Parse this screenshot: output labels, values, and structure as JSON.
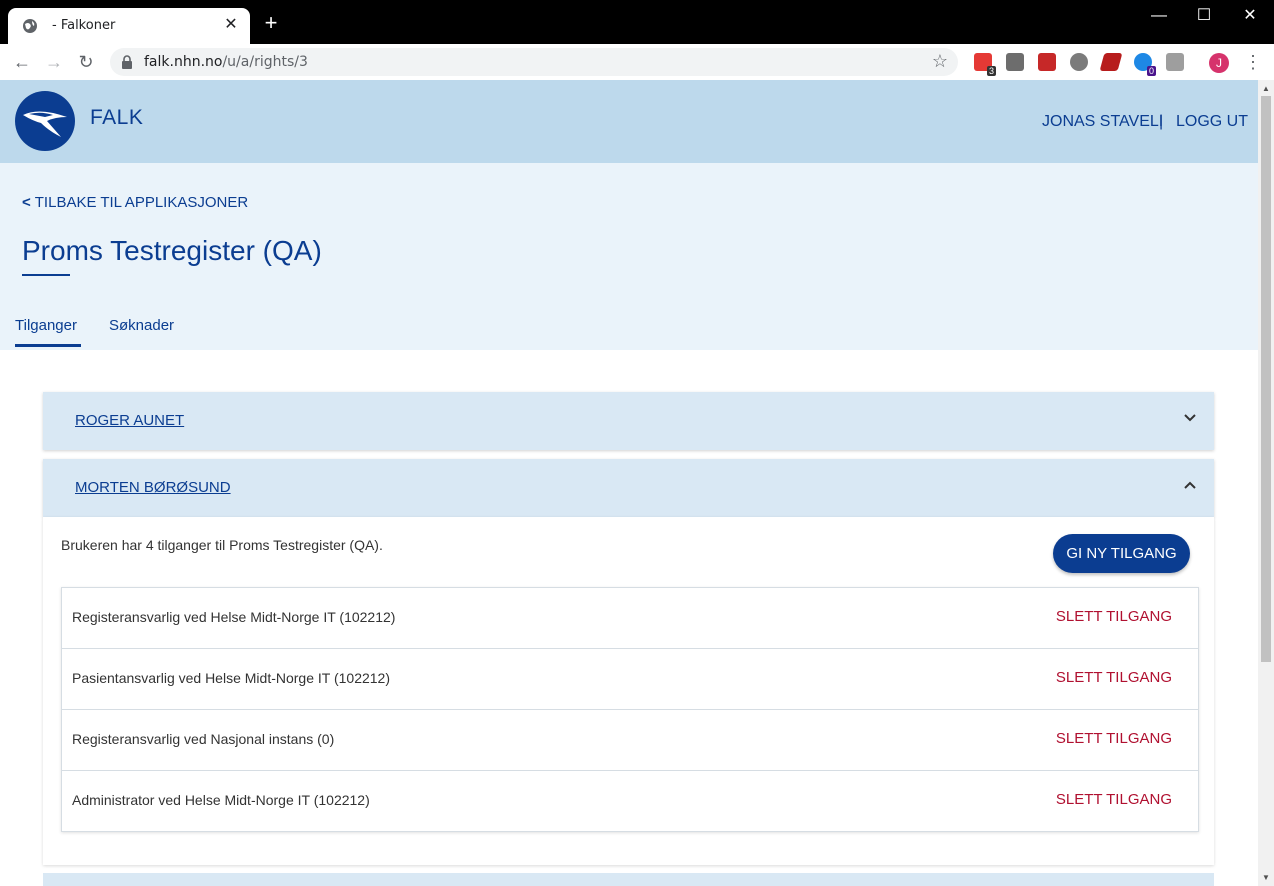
{
  "browser": {
    "tab_title": "- Falkoner",
    "url_host": "falk.nhn.no",
    "url_path": "/u/a/rights/3",
    "avatar_letter": "J",
    "ext_badge_1": "3",
    "ext_badge_2": "0"
  },
  "header": {
    "brand": "FALK",
    "user": "JONAS STAVELI",
    "separator": "|",
    "logout": "LOGG UT"
  },
  "hero": {
    "back_label": "TILBAKE TIL APPLIKASJONER",
    "title": "Proms Testregister (QA)",
    "tabs": [
      "Tilganger",
      "Søknader"
    ]
  },
  "users": [
    {
      "name": "ROGER AUNET",
      "expanded": false
    },
    {
      "name": "MORTEN BØRØSUND",
      "expanded": true
    }
  ],
  "detail": {
    "info": "Brukeren har 4 tilganger til Proms Testregister (QA).",
    "give_button": "GI NY TILGANG",
    "delete_label": "SLETT TILGANG",
    "rights": [
      "Registeransvarlig ved Helse Midt-Norge IT (102212)",
      "Pasientansvarlig ved Helse Midt-Norge IT (102212)",
      "Registeransvarlig ved Nasjonal instans (0)",
      "Administrator ved Helse Midt-Norge IT (102212)"
    ]
  },
  "colors": {
    "primary": "#0b3d91",
    "header_bg": "#bdd9ec",
    "hero_bg": "#eaf3fa",
    "panel_bg": "#d9e8f4",
    "danger": "#b01030"
  }
}
